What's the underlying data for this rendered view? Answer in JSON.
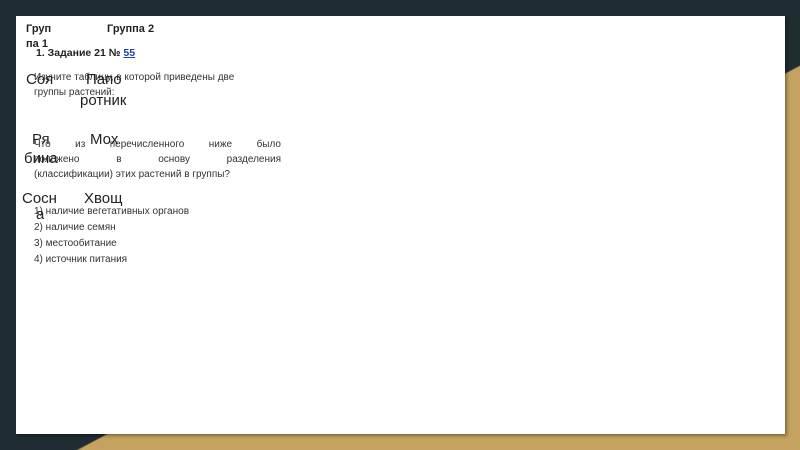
{
  "table": {
    "header_col1_line1": "Груп",
    "header_col1_line2": "па 1",
    "header_col2": "Группа 2",
    "rows": [
      {
        "col1": "Соя",
        "col2": "Папо",
        "col2_cont": "ротник"
      },
      {
        "col1": "Ря",
        "col1_cont": "бина",
        "col2": "Мох"
      },
      {
        "col1": "Сосн",
        "col1_cont": "а",
        "col2": "Хвощ"
      }
    ]
  },
  "task": {
    "title": "1. Задание 21 №",
    "link": "55",
    "intro_line1": "Изучите таблицу, в которой приведены две",
    "intro_line2": "группы растений:",
    "question_line1": "Что из перечисленного ниже было",
    "question_line2": "положено в основу разделения",
    "question_line3": "(классификации) этих растений в группы?",
    "options": [
      "1) наличие вегетативных органов",
      "2) наличие семян",
      "3) местообитание",
      "4) источник питания"
    ]
  }
}
